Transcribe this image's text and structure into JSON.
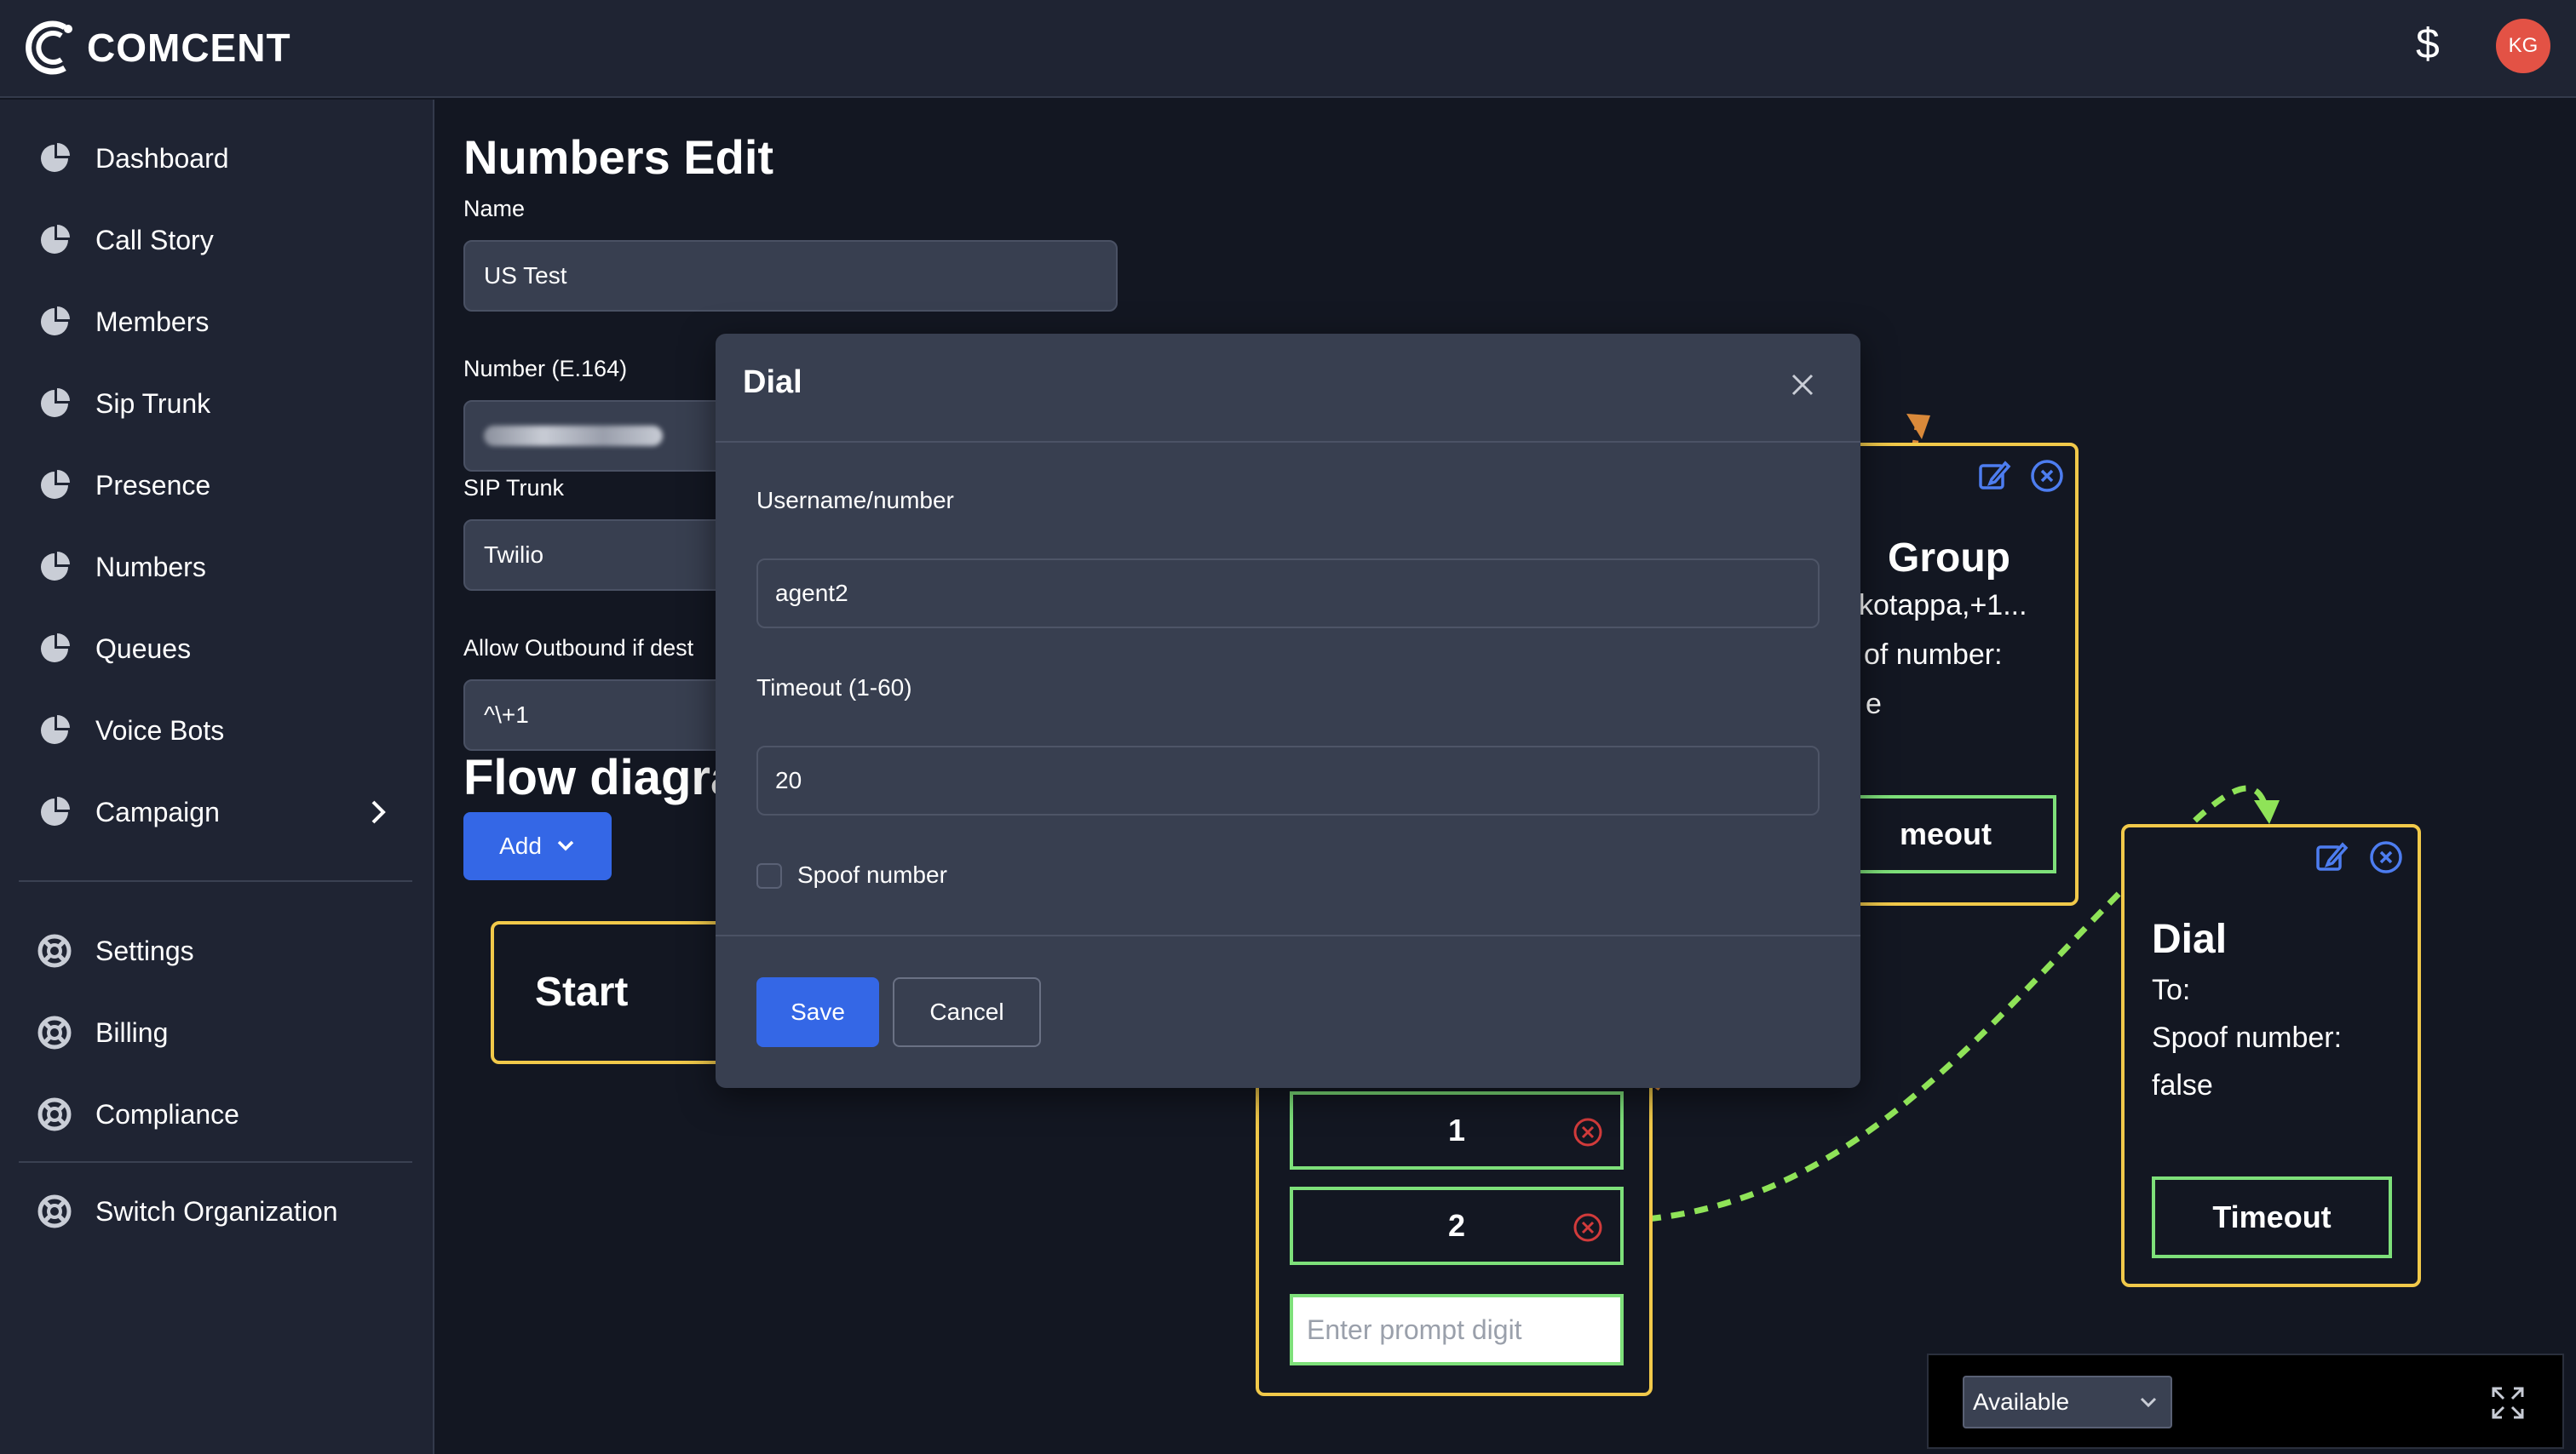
{
  "app": {
    "brand": "COMCENT",
    "currency_icon": "$",
    "user_initials": "KG",
    "accent_color": "#3467e6"
  },
  "sidebar": {
    "items": [
      {
        "label": "Dashboard",
        "icon": "pie-chart-icon"
      },
      {
        "label": "Call Story",
        "icon": "pie-chart-icon"
      },
      {
        "label": "Members",
        "icon": "pie-chart-icon"
      },
      {
        "label": "Sip Trunk",
        "icon": "pie-chart-icon"
      },
      {
        "label": "Presence",
        "icon": "pie-chart-icon"
      },
      {
        "label": "Numbers",
        "icon": "pie-chart-icon"
      },
      {
        "label": "Queues",
        "icon": "pie-chart-icon"
      },
      {
        "label": "Voice Bots",
        "icon": "pie-chart-icon"
      },
      {
        "label": "Campaign",
        "icon": "pie-chart-icon"
      }
    ],
    "settings_items": [
      {
        "label": "Settings",
        "icon": "lifebuoy-icon"
      },
      {
        "label": "Billing",
        "icon": "lifebuoy-icon"
      },
      {
        "label": "Compliance",
        "icon": "lifebuoy-icon"
      }
    ],
    "org_item": {
      "label": "Switch Organization",
      "icon": "lifebuoy-icon"
    }
  },
  "page": {
    "title": "Numbers Edit",
    "name_label": "Name",
    "name_value": "US Test",
    "number_label": "Number (E.164)",
    "sip_trunk_label": "SIP Trunk",
    "sip_trunk_value": "Twilio",
    "outbound_label": "Allow Outbound if dest",
    "outbound_value": "^\\+1",
    "flow_title": "Flow diagra",
    "add_label": "Add"
  },
  "flow": {
    "start_node": {
      "title": "Start"
    },
    "group_node": {
      "title": "Group",
      "line1": "kotappa,+1...",
      "line2": "of number:",
      "line3": "e",
      "timeout_label": "meout"
    },
    "menu_node": {
      "options": [
        "1",
        "2"
      ],
      "prompt_placeholder": "Enter prompt digit"
    },
    "dial_node": {
      "title": "Dial",
      "to_label": "To:",
      "spoof_label": "Spoof number:",
      "spoof_value": "false",
      "timeout_label": "Timeout"
    }
  },
  "modal": {
    "title": "Dial",
    "username_label": "Username/number",
    "username_value": "agent2",
    "timeout_label": "Timeout (1-60)",
    "timeout_value": "20",
    "spoof_label": "Spoof number",
    "save_label": "Save",
    "cancel_label": "Cancel"
  },
  "status": {
    "value": "Available"
  }
}
